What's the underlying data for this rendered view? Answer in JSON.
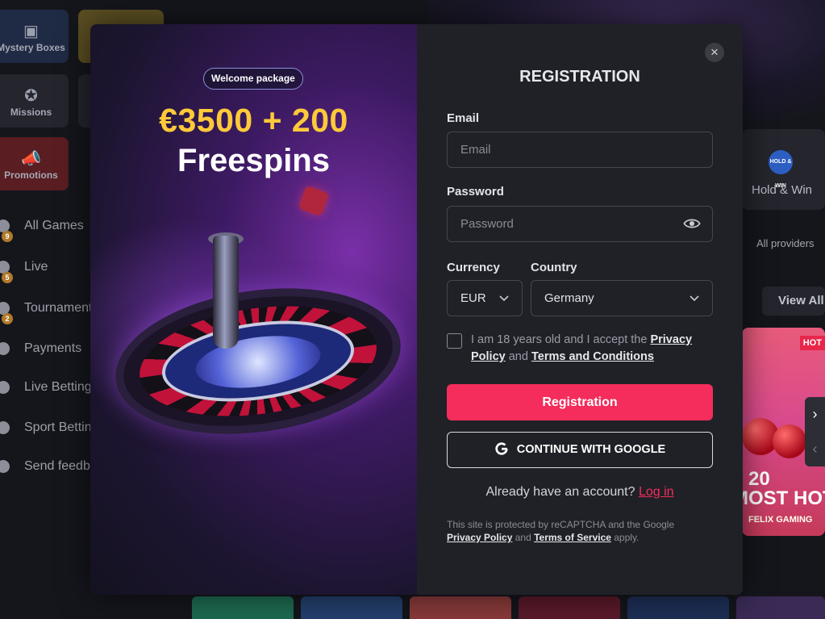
{
  "background": {
    "tiles": [
      {
        "label": "Mystery Boxes",
        "icon": "chest-icon"
      },
      {
        "label": "Missions",
        "icon": "medal-icon"
      },
      {
        "label": "Promotions",
        "icon": "megaphone-icon"
      }
    ],
    "nav": [
      {
        "label": "All Games",
        "badge": "9"
      },
      {
        "label": "Live",
        "badge": "5"
      },
      {
        "label": "Tournaments",
        "badge": "2"
      },
      {
        "label": "Payments"
      },
      {
        "label": "Live Betting"
      },
      {
        "label": "Sport Betting"
      },
      {
        "label": "Send feedback"
      }
    ],
    "hold_win": {
      "label": "Hold & Win",
      "icon_text": "HOLD & WIN"
    },
    "all_providers": "All providers",
    "view_all": "View All",
    "game_card": {
      "badge": "HOT",
      "title_line1": "20",
      "title_line2": "MOST HOT",
      "provider": "FELIX GAMING"
    },
    "slider_next": "›",
    "slider_prev": "‹"
  },
  "promo": {
    "pill": "Welcome package",
    "amount": "€3500 + 200",
    "spins": "Freespins"
  },
  "form": {
    "title": "REGISTRATION",
    "close": "×",
    "email": {
      "label": "Email",
      "placeholder": "Email",
      "value": ""
    },
    "password": {
      "label": "Password",
      "placeholder": "Password",
      "value": ""
    },
    "currency": {
      "label": "Currency",
      "value": "EUR"
    },
    "country": {
      "label": "Country",
      "value": "Germany"
    },
    "terms": {
      "prefix": "I am 18 years old and I accept the ",
      "privacy": "Privacy Policy",
      "and": " and ",
      "terms": "Terms and Conditions"
    },
    "register_button": "Registration",
    "google_button": "CONTINUE WITH GOOGLE",
    "already": {
      "text": "Already have an account? ",
      "login": "Log in"
    },
    "recaptcha": {
      "prefix": "This site is protected by reCAPTCHA and the Google ",
      "privacy": "Privacy Policy",
      "and": " and ",
      "terms": "Terms of Service",
      "suffix": " apply."
    }
  },
  "colors": {
    "accent": "#f42d5c",
    "gold": "#ffc93a",
    "modal_bg": "#202127"
  }
}
